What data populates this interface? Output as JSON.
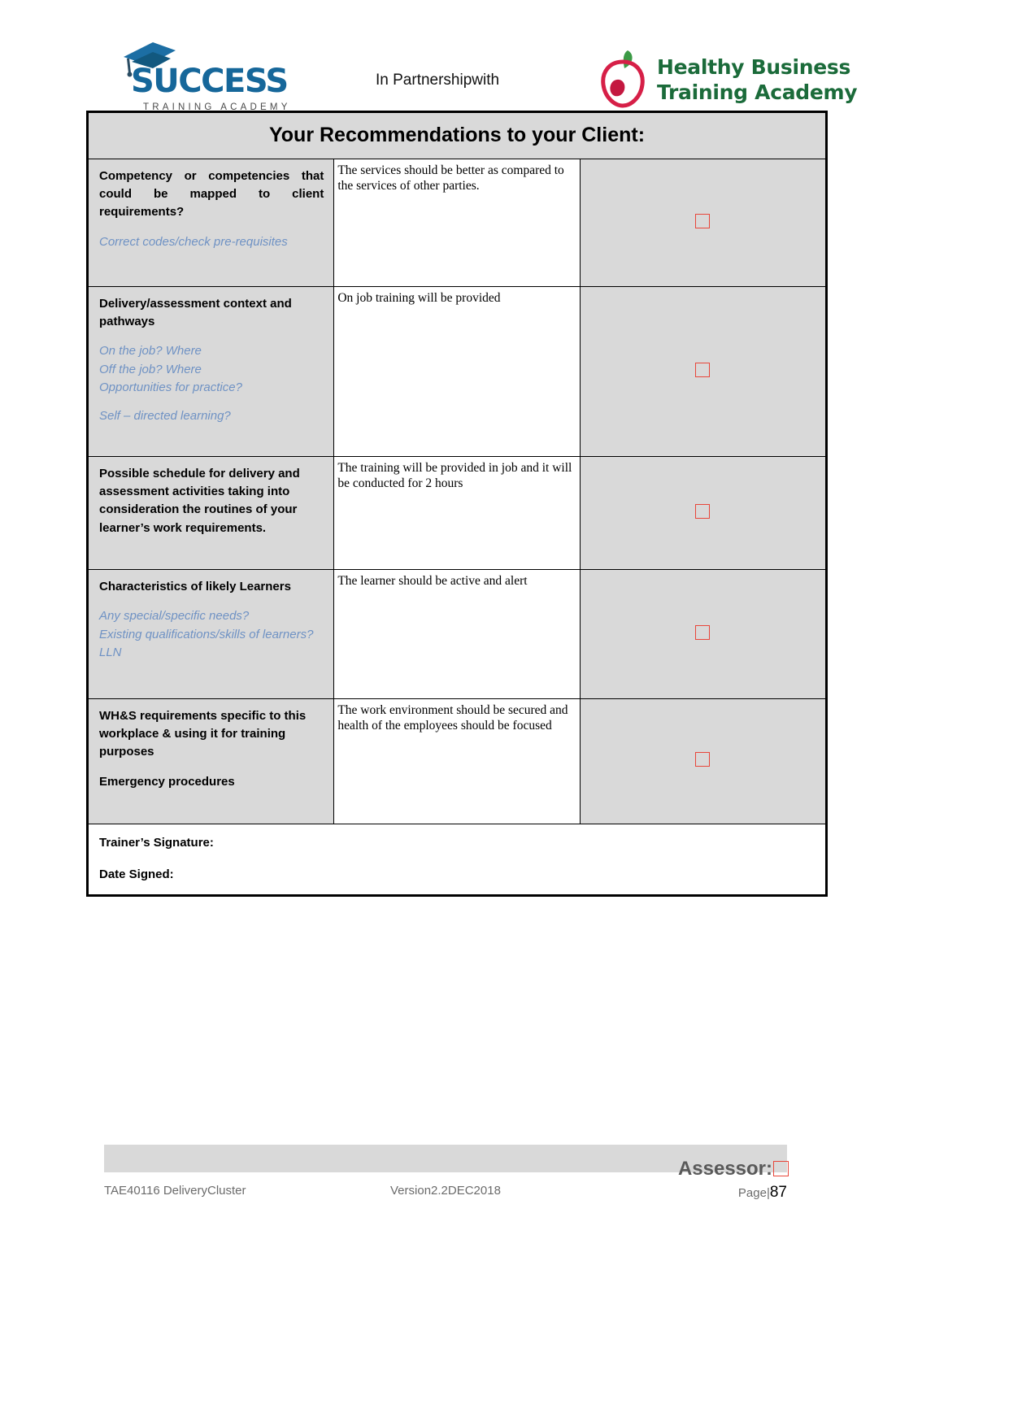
{
  "header": {
    "left_logo": {
      "word": "SUCCESS",
      "subtitle": "TRAINING ACADEMY"
    },
    "partnership_text": "In Partnershipwith",
    "right_logo": {
      "line1": "Healthy Business",
      "line2": "Training Academy"
    }
  },
  "table": {
    "title": "Your Recommendations to your Client:",
    "rows": [
      {
        "label": "Competency or competencies that could be mapped to client requirements?",
        "hints": [
          "Correct codes/check pre-requisites"
        ],
        "answer": "The services should be better as compared to the services of other parties.",
        "checked": false
      },
      {
        "label": "Delivery/assessment context and pathways",
        "hints": [
          "On the job? Where\nOff the job? Where\nOpportunities for practice?",
          "Self – directed learning?"
        ],
        "answer": "On job training will be provided",
        "checked": false
      },
      {
        "label": "Possible schedule for delivery and assessment activities taking into consideration the routines of your learner’s work requirements.",
        "hints": [],
        "answer": "The training will be  provided in job and it will be conducted for 2 hours",
        "checked": false
      },
      {
        "label": "Characteristics of likely Learners",
        "hints": [
          "Any special/specific needs?\nExisting qualifications/skills of learners? LLN"
        ],
        "answer": "The learner should be active and alert",
        "checked": false
      },
      {
        "label": "WH&S requirements specific to this workplace & using it for training purposes",
        "hints": [],
        "label2": "Emergency procedures",
        "answer": "The work environment should be secured and health of the employees should be focused",
        "checked": false
      }
    ],
    "signature": {
      "trainer_label": "Trainer’s Signature:",
      "date_label": "Date Signed:"
    }
  },
  "footer": {
    "assessor_label": "Assessor:",
    "left": "TAE40116 DeliveryCluster",
    "middle": "Version2.2DEC2018",
    "page_label": "Page",
    "page_separator": "|",
    "page_number": "87"
  },
  "colors": {
    "header_fill": "#d9d9d9",
    "hint_blue": "#6f92c4",
    "checkbox_red": "#e8463a",
    "success_blue": "#16679a",
    "hbta_green": "#1b6b3a",
    "apple_red": "#d61f47"
  }
}
